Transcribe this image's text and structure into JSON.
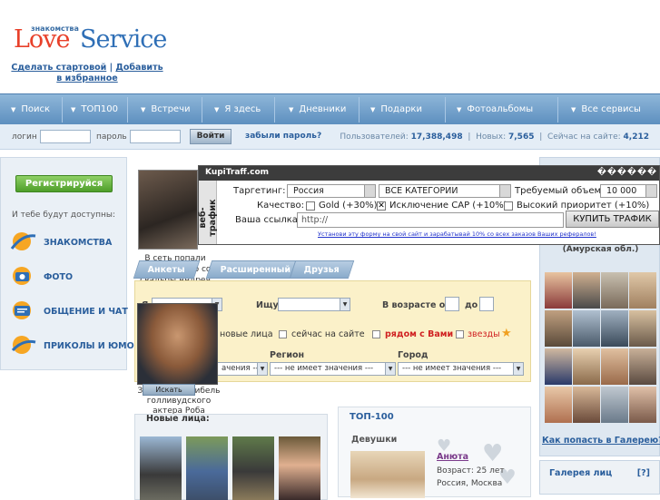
{
  "header": {
    "logo_small": "знакомства",
    "logo_love": "Love",
    "logo_service": "Service",
    "links": [
      "Сделать стартовой",
      "Добавить в избранное"
    ],
    "links_sep": "|"
  },
  "nav": {
    "items": [
      "Поиск",
      "ТОП100",
      "Встречи",
      "Я здесь",
      "Дневники",
      "Подарки",
      "Фотоальбомы",
      "Все сервисы"
    ],
    "arrow": "▼"
  },
  "login": {
    "login_label": "логин",
    "password_label": "пароль",
    "submit": "Войти",
    "forgot": "забыли пароль?",
    "stats": {
      "users_label": "Пользователей:",
      "users": "17,388,498",
      "new_label": "Новых:",
      "new": "7,565",
      "online_label": "Сейчас на сайте:",
      "online": "4,212"
    }
  },
  "sidebar": {
    "register": "Регистрируйся",
    "note": "И тебе будут доступны:",
    "features": [
      "ЗНАКОМСТВА",
      "ФОТО",
      "ОБЩЕНИЕ И ЧАТ",
      "ПРИКОЛЫ И ЮМОР"
    ]
  },
  "center": {
    "photo_caption": "В сеть попали ТАЙНЫЕ фото со свадьбы Андрея Малахова",
    "tabs": [
      "Анкеты",
      "Расширенный",
      "Друзья"
    ],
    "search": {
      "ya_label": "Я",
      "ishu_label": "Ищу",
      "age_from": "В возрасте от",
      "age_to": "до",
      "opt_new": "новые лица",
      "opt_online": "сейчас на сайте",
      "opt_near": "рядом с Вами",
      "opt_stars": "звезды",
      "region_label": "Регион",
      "city_label": "Город",
      "country_value": "ачения ---",
      "region_value": "--- не имеет значения ---",
      "city_value": "--- не имеет значения ---"
    },
    "avatar_caption": "Загадочная гибель голливудского актера Роба Шнайдера",
    "search_button": "Искать",
    "new_faces_title": "Новые лица:"
  },
  "top100": {
    "title": "ТОП-100",
    "subtitle": "Девушки",
    "name": "Анюта",
    "age": "Возраст: 25 лет",
    "city": "Россия, Москва"
  },
  "right": {
    "caption": "(Амурская обл.)",
    "gallery_link": "Как попасть в Галерею?",
    "gallery_title": "Галерея лиц",
    "gallery_help": "[?]"
  },
  "ad": {
    "title": "KupiTraff.com",
    "title_junk": "������",
    "side": "веб-трафик",
    "targeting_label": "Таргетинг:",
    "country": "Россия",
    "category": "ВСЕ КАТЕГОРИИ",
    "volume_label": "Требуемый объем:",
    "volume": "10 000",
    "quality_label": "Качество:",
    "opt_gold": "Gold (+30%)",
    "opt_cap": "Исключение CAP (+10%)",
    "opt_priority": "Высокий приоритет (+10%)",
    "url_label": "Ваша ссылка:",
    "url_value": "http://",
    "buy": "КУПИТЬ ТРАФИК",
    "footer": "Установи эту форму на свой сайт и зарабатывай 10% со всех заказов Ваших рефералов!"
  },
  "colors": {
    "nav": "#6f9ccb",
    "brand_red": "#e8402a",
    "brand_blue": "#2f6fb6",
    "register": "#5aaa33"
  }
}
